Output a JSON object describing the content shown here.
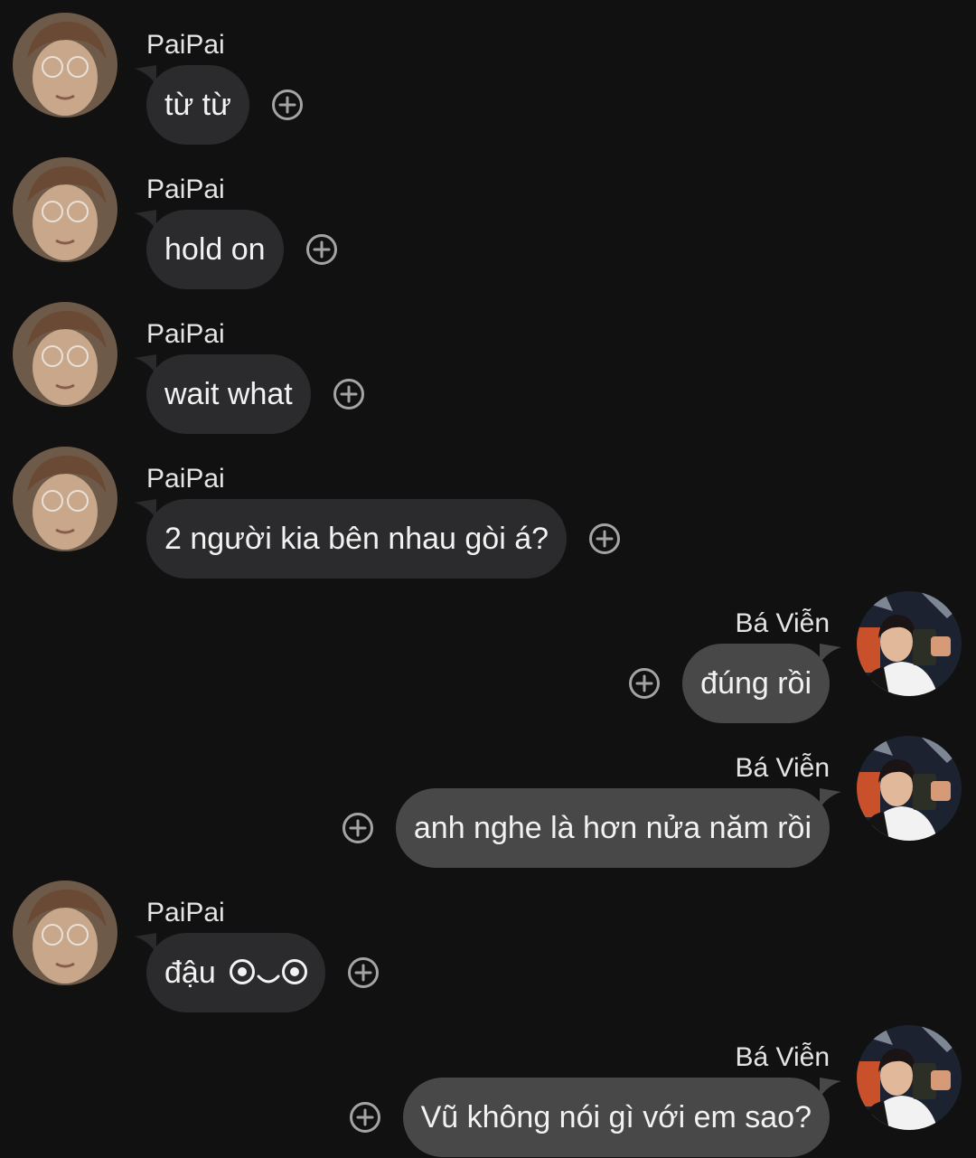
{
  "colors": {
    "background": "#111112",
    "incoming_bubble": "#2b2b2d",
    "outgoing_bubble": "#484849",
    "text": "#f2f2f2",
    "react_icon": "#a4a4a4"
  },
  "icons": {
    "react": "add-reaction-icon",
    "emoticon_eye": "circle-eye-icon",
    "emoticon_mouth": "curved-mouth-icon"
  },
  "messages": [
    {
      "direction": "incoming",
      "sender": "PaiPai",
      "text": "từ từ"
    },
    {
      "direction": "incoming",
      "sender": "PaiPai",
      "text": "hold on"
    },
    {
      "direction": "incoming",
      "sender": "PaiPai",
      "text": "wait what"
    },
    {
      "direction": "incoming",
      "sender": "PaiPai",
      "text": "2 người kia bên nhau gòi á?"
    },
    {
      "direction": "outgoing",
      "sender": "Bá Viễn",
      "text": "đúng rồi"
    },
    {
      "direction": "outgoing",
      "sender": "Bá Viễn",
      "text": "anh nghe là hơn nửa năm rồi"
    },
    {
      "direction": "incoming",
      "sender": "PaiPai",
      "text": "đậu",
      "emoticon": "◉‿◉"
    },
    {
      "direction": "outgoing",
      "sender": "Bá Viễn",
      "text": "Vũ không nói gì với em sao?"
    }
  ]
}
